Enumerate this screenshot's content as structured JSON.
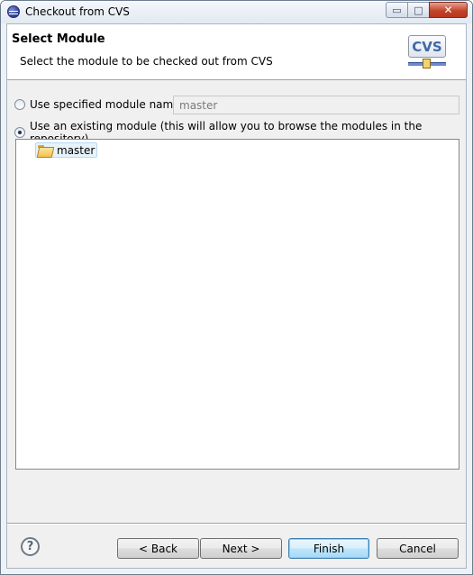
{
  "window": {
    "title": "Checkout from CVS",
    "controls": {
      "minimize": "▭",
      "maximize": "□",
      "close": "✕"
    }
  },
  "banner": {
    "title": "Select Module",
    "description": "Select the module to be checked out from CVS",
    "icon_text": "CVS"
  },
  "options": {
    "specified": {
      "label": "Use specified module name:",
      "selected": false,
      "value": "master"
    },
    "existing": {
      "label": "Use an existing module (this will allow you to browse the modules in the repository)",
      "selected": true
    }
  },
  "tree": {
    "items": [
      {
        "label": "master",
        "icon": "open-folder-icon",
        "selected": true
      }
    ]
  },
  "footer": {
    "help": "?",
    "back": "< Back",
    "next": "Next >",
    "finish": "Finish",
    "cancel": "Cancel"
  }
}
